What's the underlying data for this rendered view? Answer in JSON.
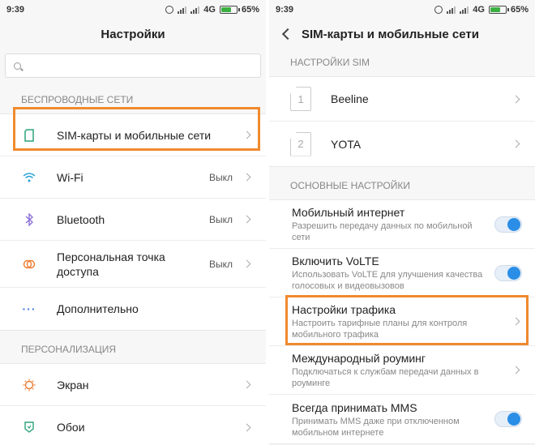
{
  "left": {
    "status": {
      "time": "9:39",
      "network": "4G",
      "battery": "65%"
    },
    "title": "Настройки",
    "search": {
      "placeholder": ""
    },
    "sections": [
      {
        "header": "БЕСПРОВОДНЫЕ СЕТИ"
      },
      {
        "header": "ПЕРСОНАЛИЗАЦИЯ"
      }
    ],
    "items": [
      {
        "label": "SIM-карты и мобильные сети",
        "value": "",
        "icon": "sim-icon",
        "color": "#2aa37a"
      },
      {
        "label": "Wi-Fi",
        "value": "Выкл",
        "icon": "wifi-icon",
        "color": "#2aa3d8"
      },
      {
        "label": "Bluetooth",
        "value": "Выкл",
        "icon": "bluetooth-icon",
        "color": "#8a6fd8"
      },
      {
        "label": "Персональная точка доступа",
        "value": "Выкл",
        "icon": "hotspot-icon",
        "color": "#f07a2e"
      },
      {
        "label": "Дополнительно",
        "value": "",
        "icon": "more-icon",
        "color": "#3a7be0"
      },
      {
        "label": "Экран",
        "value": "",
        "icon": "display-icon",
        "color": "#f07a2e"
      },
      {
        "label": "Обои",
        "value": "",
        "icon": "wallpaper-icon",
        "color": "#2aa37a"
      }
    ]
  },
  "right": {
    "status": {
      "time": "9:39",
      "network": "4G",
      "battery": "65%"
    },
    "title": "SIM-карты и мобильные сети",
    "sim_header": "НАСТРОЙКИ SIM",
    "sims": [
      {
        "num": "1",
        "name": "Beeline"
      },
      {
        "num": "2",
        "name": "YOTA"
      }
    ],
    "main_header": "ОСНОВНЫЕ НАСТРОЙКИ",
    "options": [
      {
        "title": "Мобильный интернет",
        "sub": "Разрешить передачу данных по мобильной сети",
        "control": "toggle",
        "on": true
      },
      {
        "title": "Включить VoLTE",
        "sub": "Использовать VoLTE для улучшения качества голосовых и видеовызовов",
        "control": "toggle",
        "on": true
      },
      {
        "title": "Настройки трафика",
        "sub": "Настроить тарифные планы для контроля мобильного трафика",
        "control": "chevron"
      },
      {
        "title": "Международный роуминг",
        "sub": "Подключаться к службам передачи данных в роуминге",
        "control": "chevron"
      },
      {
        "title": "Всегда принимать MMS",
        "sub": "Принимать MMS даже при отключенном мобильном интернете",
        "control": "toggle",
        "on": true
      }
    ]
  },
  "colors": {
    "highlight": "#f08a2e",
    "toggle_on": "#2a8ee6"
  }
}
